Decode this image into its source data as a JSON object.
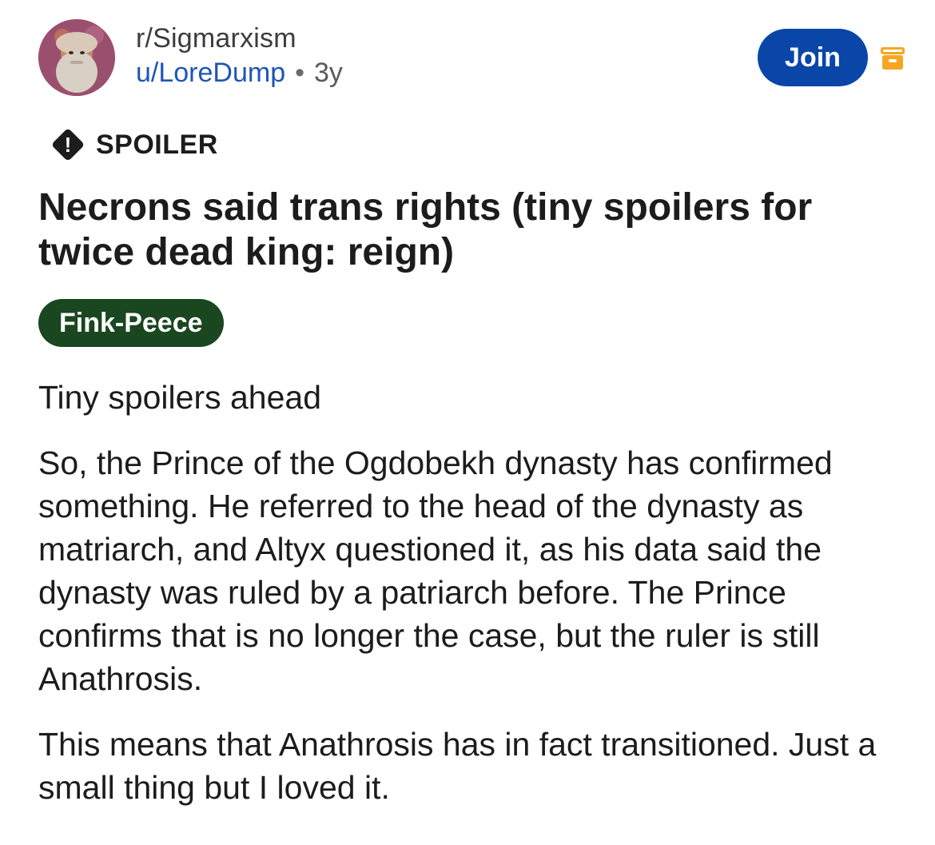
{
  "post": {
    "subreddit": "r/Sigmarxism",
    "username": "u/LoreDump",
    "separator": "•",
    "age": "3y",
    "join_label": "Join",
    "spoiler_label": "SPOILER",
    "spoiler_icon_glyph": "!",
    "title": "Necrons said trans rights (tiny spoilers for twice dead king: reign)",
    "flair": "Fink-Peece",
    "paragraphs": [
      "Tiny spoilers ahead",
      "So, the Prince of the Ogdobekh dynasty has confirmed something. He referred to the head of the dynasty as matriarch, and Altyx questioned it, as his data said the dynasty was ruled by a patriarch before. The Prince confirms that is no longer the case, but the ruler is still Anathrosis.",
      "This means that Anathrosis has in fact transitioned. Just a small thing but I loved it."
    ]
  },
  "icons": {
    "avatar": "subreddit-avatar",
    "archive": "archive-icon",
    "spoiler": "warning-diamond-icon"
  },
  "colors": {
    "join_button": "#0a46a8",
    "username": "#1f55b8",
    "flair_bg": "#1a4620",
    "archive_icon": "#f5a623"
  }
}
